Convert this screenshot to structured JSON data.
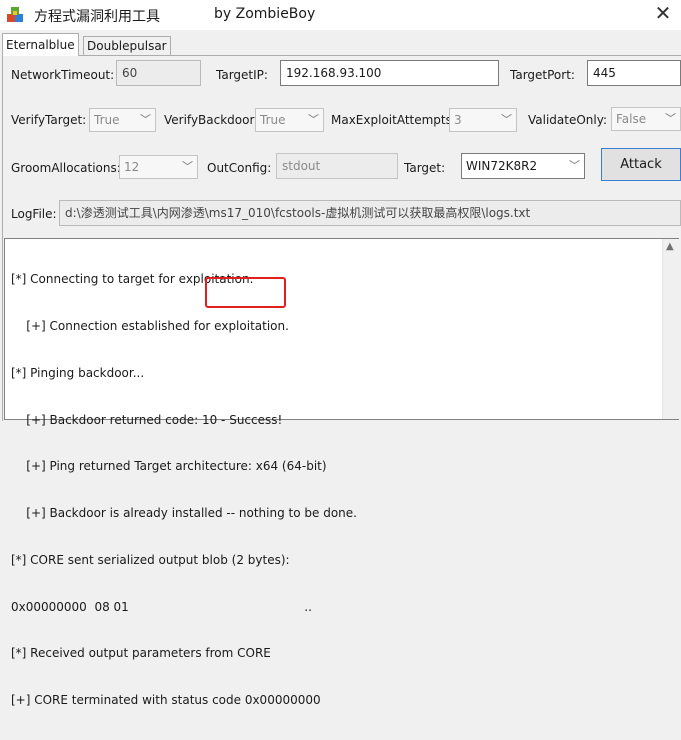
{
  "window": {
    "title": "方程式漏洞利用工具",
    "author": "by ZombieBoy",
    "close_icon": "close-icon"
  },
  "tabs": [
    {
      "label": "Eternalblue",
      "active": true
    },
    {
      "label": "Doublepulsar",
      "active": false
    }
  ],
  "form": {
    "network_timeout": {
      "label": "NetworkTimeout:",
      "value": "60"
    },
    "target_ip": {
      "label": "TargetIP:",
      "value": "192.168.93.100"
    },
    "target_port": {
      "label": "TargetPort:",
      "value": "445"
    },
    "verify_target": {
      "label": "VerifyTarget:",
      "value": "True"
    },
    "verify_backdoor": {
      "label": "VerifyBackdoor:",
      "value": "True"
    },
    "max_exploit_attempts": {
      "label": "MaxExploitAttempts:",
      "value": "3"
    },
    "validate_only": {
      "label": "ValidateOnly:",
      "value": "False"
    },
    "groom_allocations": {
      "label": "GroomAllocations:",
      "value": "12"
    },
    "out_config": {
      "label": "OutConfig:",
      "value": "stdout"
    },
    "target": {
      "label": "Target:",
      "value": "WIN72K8R2"
    },
    "attack_button": "Attack",
    "log_file": {
      "label": "LogFile:",
      "value": "d:\\渗透测试工具\\内网渗透\\ms17_010\\fcstools-虚拟机测试可以获取最高权限\\logs.txt"
    }
  },
  "console": {
    "lines": [
      "[*] Connecting to target for exploitation.",
      "    [+] Connection established for exploitation.",
      "[*] Pinging backdoor...",
      "    [+] Backdoor returned code: 10 - Success!",
      "    [+] Ping returned Target architecture: x64 (64-bit)",
      "    [+] Backdoor is already installed -- nothing to be done.",
      "[*] CORE sent serialized output blob (2 bytes):",
      "0x00000000  08 01                                              ..",
      "[*] Received output parameters from CORE",
      "[+] CORE terminated with status code 0x00000000"
    ]
  },
  "colors": {
    "highlight_border": "#e1201c",
    "button_focus_border": "#3a7fd4"
  }
}
